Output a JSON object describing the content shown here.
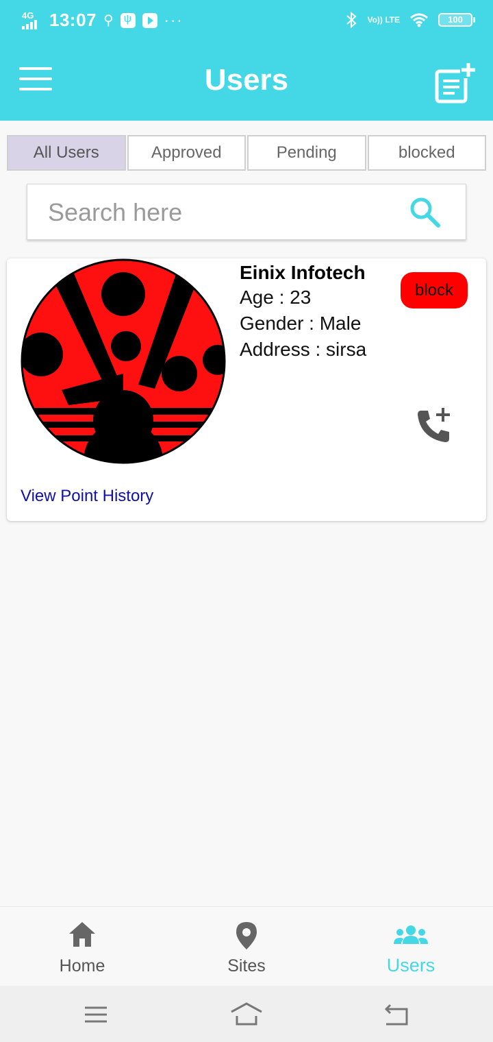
{
  "status_bar": {
    "network": "4G",
    "time": "13:07",
    "dots": "···",
    "volte": "Vo)) LTE",
    "battery": "100"
  },
  "appbar": {
    "title": "Users"
  },
  "tabs": [
    {
      "label": "All Users",
      "active": true
    },
    {
      "label": "Approved",
      "active": false
    },
    {
      "label": "Pending",
      "active": false
    },
    {
      "label": "blocked",
      "active": false
    }
  ],
  "search": {
    "placeholder": "Search here",
    "value": ""
  },
  "user_card": {
    "name": "Einix Infotech",
    "age": "Age : 23",
    "gender": "Gender : Male",
    "address": "Address : sirsa",
    "block_label": "block",
    "history_link": "View Point History"
  },
  "bottom_nav": [
    {
      "label": "Home",
      "icon": "home-icon",
      "active": false
    },
    {
      "label": "Sites",
      "icon": "map-pin-icon",
      "active": false
    },
    {
      "label": "Users",
      "icon": "group-icon",
      "active": true
    }
  ],
  "colors": {
    "primary": "#44d8e6",
    "block": "#ff0000",
    "link": "#1010a8",
    "tab_active": "#d8d3e6"
  }
}
